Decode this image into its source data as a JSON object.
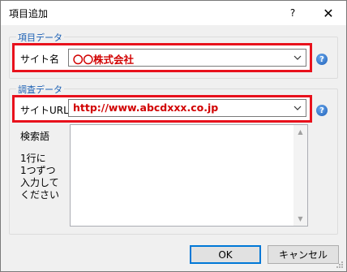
{
  "window": {
    "title": "項目追加",
    "help_label": "?",
    "close_label": "✕"
  },
  "item_group": {
    "legend": "項目データ",
    "site_name_label": "サイト名",
    "site_name_value": "〇〇株式会社"
  },
  "survey_group": {
    "legend": "調査データ",
    "site_url_label": "サイトURL",
    "site_url_value": "http://www.abcdxxx.co.jp",
    "keyword_label": "検索語",
    "keyword_hint": [
      "1行に",
      "1つずつ",
      "入力して",
      "ください"
    ],
    "keyword_value": ""
  },
  "buttons": {
    "ok_label": "OK",
    "cancel_label": "キャンセル"
  },
  "colors": {
    "highlight": "#e8111c",
    "value_text": "#d10000",
    "legend_text": "#1a5fb4"
  }
}
